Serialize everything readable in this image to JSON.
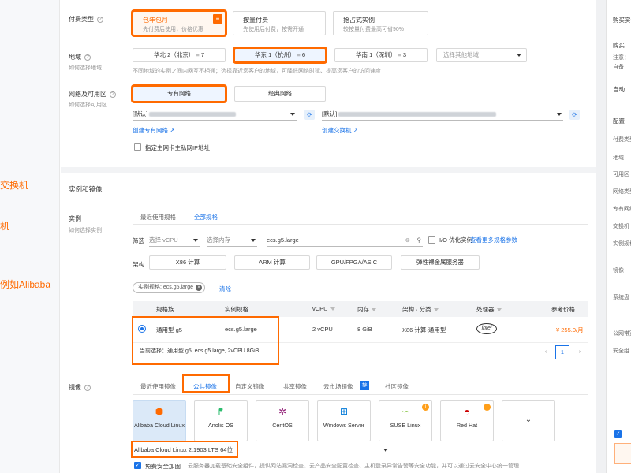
{
  "left_fragments": [
    "交换机",
    "机",
    "例如Alibaba"
  ],
  "billing": {
    "label": "付费类型",
    "options": [
      {
        "title": "包年包月",
        "sub": "先付费后使用，价格优惠"
      },
      {
        "title": "按量付费",
        "sub": "先使用后付费，按需开通"
      },
      {
        "title": "抢占式实例",
        "sub": "较按量付费最高可省90%"
      }
    ],
    "flag_icon": "≡"
  },
  "region": {
    "label": "地域",
    "sub": "如何选择地域",
    "options": [
      "华北 2（北京）",
      "华东 1（杭州）",
      "华南 1（深圳）"
    ],
    "counts": [
      "7",
      "6",
      "3"
    ],
    "other_placeholder": "选择其他地域",
    "hint": "不同地域的实例之间内网互不相通；选择靠近您客户的地域，可降低网络时延、提高您客户的访问速度"
  },
  "network": {
    "label": "网络及可用区",
    "sub": "如何选择可用区",
    "options": [
      "专有网络",
      "经典网络"
    ],
    "vpc_prefix": "[默认]",
    "vswitch_prefix": "[默认]",
    "create_vpc": "创建专有网络",
    "create_vswitch": "创建交换机",
    "assign_ip": "指定主网卡主私网IP地址"
  },
  "section_instance_title": "实例和镜像",
  "instance": {
    "label": "实例",
    "sub": "如何选择实例",
    "tabs": [
      "最近使用规格",
      "全部规格"
    ],
    "filter_label": "筛选",
    "vcpu_placeholder": "选择 vCPU",
    "mem_placeholder": "选择内存",
    "search_value": "ecs.g5.large",
    "io_opt": "I/O 优化实例",
    "more_params": "查看更多规格参数",
    "arch_label": "架构",
    "arch_options": [
      "X86 计算",
      "ARM 计算",
      "GPU/FPGA/ASIC",
      "弹性裸金属服务器"
    ],
    "tag_text": "实例规格: ecs.g5.large",
    "clear_text": "清除",
    "columns": [
      "规格族",
      "实例规格",
      "vCPU",
      "内存",
      "架构 · 分类",
      "处理器",
      "参考价格"
    ],
    "row": {
      "family": "通用型 g5",
      "spec": "ecs.g5.large",
      "vcpu": "2 vCPU",
      "mem": "8 GiB",
      "arch": "X86 计算-通用型",
      "cpu_logo": "intel",
      "price": "¥ 255.0/月"
    },
    "current_selection": "当前选择：通用型 g5, ecs.g5.large, 2vCPU 8GiB",
    "page": "1"
  },
  "image": {
    "label": "镜像",
    "tabs": [
      "最近使用镜像",
      "公共镜像",
      "自定义镜像",
      "共享镜像",
      "云市场镜像",
      "社区镜像"
    ],
    "market_badge": "荐",
    "os_cards": [
      "Alibaba Cloud Linux",
      "Anolis OS",
      "CentOS",
      "Windows Server",
      "SUSE Linux",
      "Red Hat"
    ],
    "version": "Alibaba Cloud Linux 2.1903 LTS 64位",
    "free_security": "免费安全加固",
    "security_desc": "云服务器加载基础安全组件，提供网站漏洞检查、云产品安全配置检查、主机登录异常告警等安全功能，并可以通过云安全中心统一管理"
  },
  "right_panel": {
    "title": "购买实例",
    "items": [
      "购买",
      "注意：",
      "自备",
      "自动",
      "配置",
      "付费类型",
      "地域",
      "可用区",
      "网络类型",
      "专有网络",
      "交换机",
      "实例规格",
      "镜像",
      "系统盘",
      "公网带宽",
      "安全组"
    ]
  }
}
